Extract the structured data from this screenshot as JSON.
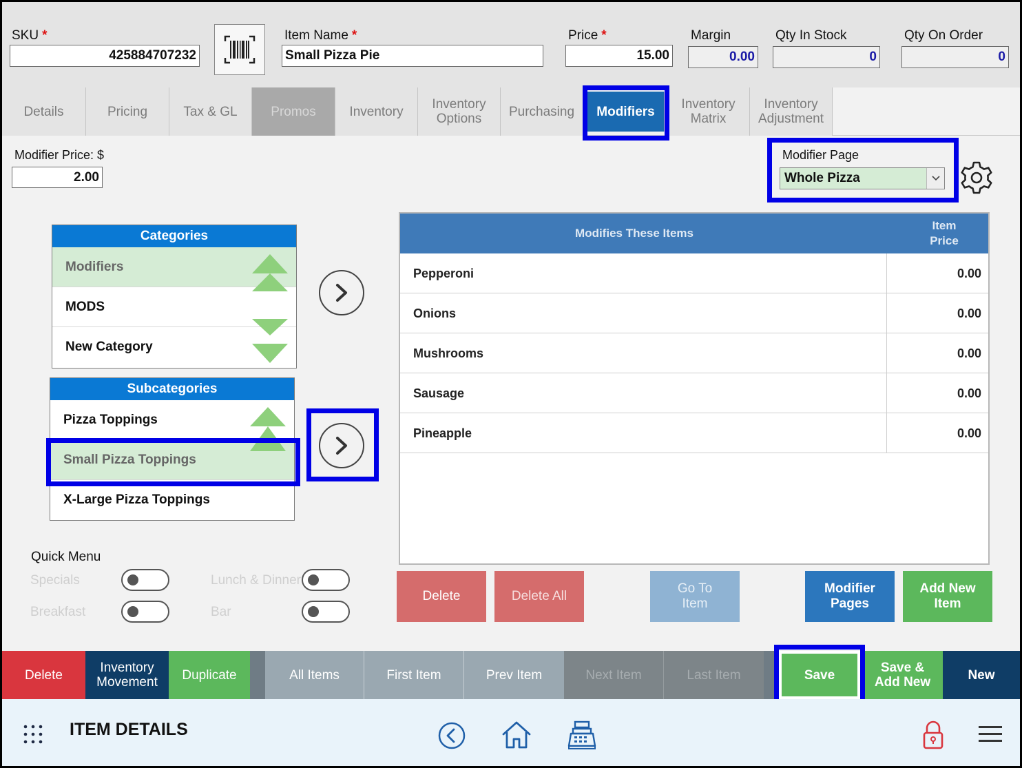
{
  "header": {
    "sku_label": "SKU",
    "sku_value": "425884707232",
    "item_name_label": "Item Name",
    "item_name_value": "Small Pizza Pie",
    "price_label": "Price",
    "price_value": "15.00",
    "margin_label": "Margin",
    "margin_value": "0.00",
    "qty_in_stock_label": "Qty In Stock",
    "qty_in_stock_value": "0",
    "qty_on_order_label": "Qty On Order",
    "qty_on_order_value": "0",
    "required_mark": "*",
    "barcode_icon": "barcode-icon"
  },
  "tabs": [
    {
      "label": "Details"
    },
    {
      "label": "Pricing"
    },
    {
      "label": "Tax & GL"
    },
    {
      "label": "Promos"
    },
    {
      "label": "Inventory"
    },
    {
      "label": "Inventory Options"
    },
    {
      "label": "Purchasing"
    },
    {
      "label": "Modifiers"
    },
    {
      "label": "Inventory Matrix"
    },
    {
      "label": "Inventory Adjustment"
    }
  ],
  "active_tab": "Modifiers",
  "modifier_price": {
    "label": "Modifier Price: $",
    "value": "2.00"
  },
  "modifier_page": {
    "label": "Modifier Page",
    "selected": "Whole Pizza"
  },
  "categories": {
    "title": "Categories",
    "items": [
      {
        "label": "Modifiers",
        "selected": true
      },
      {
        "label": "MODS",
        "selected": false
      },
      {
        "label": "New Category",
        "selected": false
      }
    ]
  },
  "subcategories": {
    "title": "Subcategories",
    "items": [
      {
        "label": "Pizza Toppings",
        "selected": false
      },
      {
        "label": "Small Pizza Toppings",
        "selected": true
      },
      {
        "label": "X-Large Pizza Toppings",
        "selected": false
      }
    ]
  },
  "modifies_table": {
    "col_item": "Modifies These Items",
    "col_price": "Item Price",
    "rows": [
      {
        "name": "Pepperoni",
        "price": "0.00"
      },
      {
        "name": "Onions",
        "price": "0.00"
      },
      {
        "name": "Mushrooms",
        "price": "0.00"
      },
      {
        "name": "Sausage",
        "price": "0.00"
      },
      {
        "name": "Pineapple",
        "price": "0.00"
      }
    ]
  },
  "table_actions": {
    "delete": "Delete",
    "delete_all": "Delete All",
    "go_to_item": "Go To Item",
    "modifier_pages": "Modifier Pages",
    "add_new_item": "Add New Item"
  },
  "quick_menu": {
    "title": "Quick Menu",
    "items": [
      {
        "label": "Specials",
        "on": false
      },
      {
        "label": "Lunch & Dinner",
        "on": false
      },
      {
        "label": "Breakfast",
        "on": false
      },
      {
        "label": "Bar",
        "on": false
      }
    ]
  },
  "action_bar": {
    "delete": "Delete",
    "inventory_movement": "Inventory Movement",
    "duplicate": "Duplicate",
    "all_items": "All Items",
    "first_item": "First Item",
    "prev_item": "Prev Item",
    "next_item": "Next Item",
    "last_item": "Last Item",
    "save": "Save",
    "save_add_new": "Save & Add New",
    "new": "New"
  },
  "footer": {
    "title": "ITEM DETAILS"
  },
  "colors": {
    "tab_active": "#1a6ab1",
    "list_header": "#0a79d4",
    "selected_row": "#d5ecd5",
    "arrow_green": "#8ed07c",
    "highlight": "#0000e6",
    "delete_red": "#d56c6c",
    "green": "#5cb85c",
    "navy": "#0f3d66",
    "grey_btn": "#9aa8b1"
  }
}
